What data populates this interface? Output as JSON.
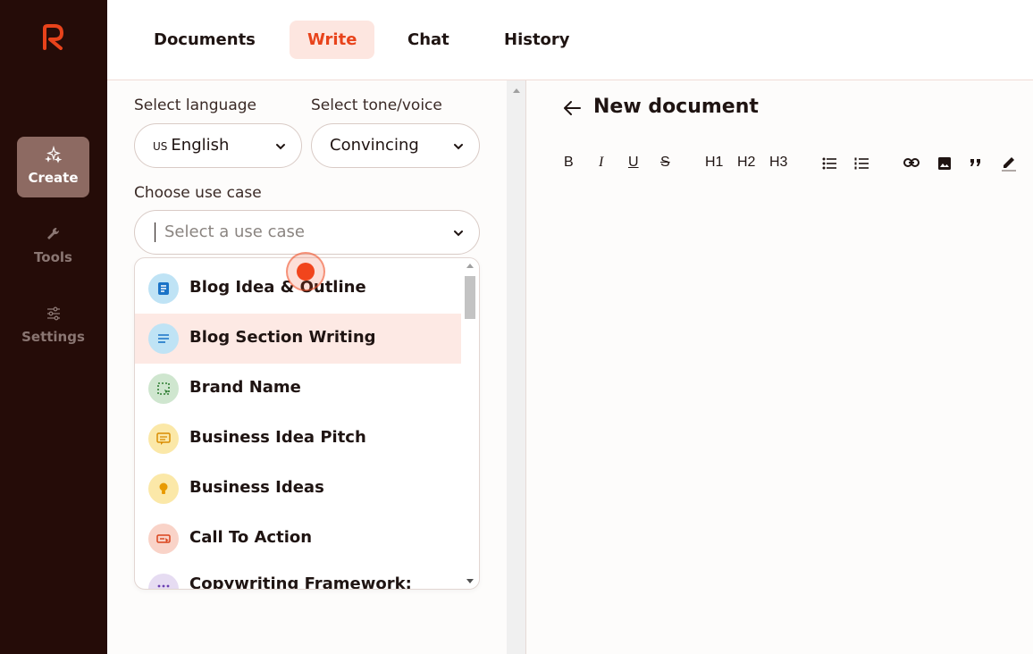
{
  "nav": {
    "tabs": [
      {
        "label": "Documents"
      },
      {
        "label": "Write"
      },
      {
        "label": "Chat"
      },
      {
        "label": "History"
      }
    ],
    "active_tab": "Write"
  },
  "rail": {
    "items": [
      {
        "label": "Create",
        "icon": "sparkles-icon"
      },
      {
        "label": "Tools",
        "icon": "wrench-icon"
      },
      {
        "label": "Settings",
        "icon": "sliders-icon"
      }
    ],
    "active": "Create"
  },
  "form": {
    "language_label": "Select language",
    "language_flag": "US",
    "language_value": "English",
    "tone_label": "Select tone/voice",
    "tone_value": "Convincing",
    "usecase_label": "Choose use case",
    "usecase_placeholder": "Select a use case"
  },
  "usecases": [
    {
      "label": "Blog Idea & Outline",
      "icon": "document-icon",
      "bg": "#bfe3f5",
      "fg": "#1a73c7"
    },
    {
      "label": "Blog Section Writing",
      "icon": "lines-icon",
      "bg": "#bfe3f5",
      "fg": "#1a73c7"
    },
    {
      "label": "Brand Name",
      "icon": "selection-icon",
      "bg": "#cfe6cf",
      "fg": "#2e7d32"
    },
    {
      "label": "Business Idea Pitch",
      "icon": "chat-icon",
      "bg": "#fbe8a8",
      "fg": "#d98c00"
    },
    {
      "label": "Business Ideas",
      "icon": "bulb-icon",
      "bg": "#fbe8a8",
      "fg": "#d98c00"
    },
    {
      "label": "Call To Action",
      "icon": "cta-icon",
      "bg": "#f9d3c8",
      "fg": "#d9431b"
    },
    {
      "label": "Copywriting Framework:",
      "icon": "grid-icon",
      "bg": "#e6dcf2",
      "fg": "#6a3fb0"
    }
  ],
  "editor": {
    "title": "New document",
    "toolbar": [
      "B",
      "I",
      "U",
      "S",
      "H1",
      "H2",
      "H3"
    ]
  },
  "colors": {
    "accent": "#e8431b",
    "rail_bg": "#250c08",
    "rail_active": "#8d6a62"
  }
}
